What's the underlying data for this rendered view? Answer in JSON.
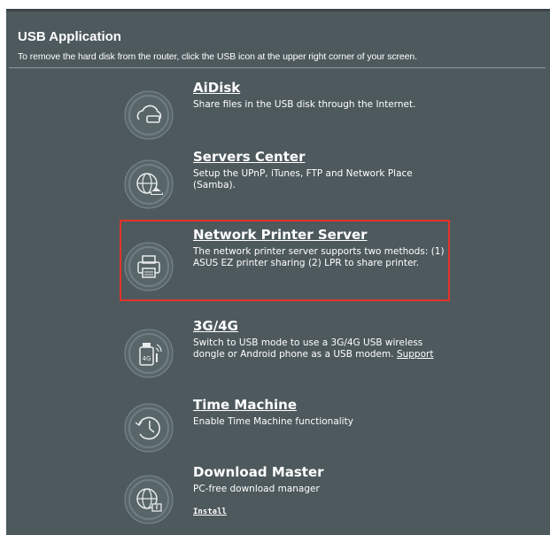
{
  "header": {
    "title": "USB Application",
    "subtitle": "To remove the hard disk from the router, click the USB icon at the upper right corner of your screen."
  },
  "apps": [
    {
      "title": "AiDisk",
      "description": "Share files in the USB disk through the Internet.",
      "icon": "cloud-disk-icon"
    },
    {
      "title": "Servers Center",
      "description": "Setup the UPnP, iTunes, FTP and Network Place (Samba).",
      "icon": "globe-server-icon"
    },
    {
      "title": "Network Printer Server",
      "description": "The network printer server supports two methods: (1) ASUS EZ printer sharing (2) LPR to share printer.",
      "icon": "printer-icon",
      "highlighted": true
    },
    {
      "title": "3G/4G",
      "description": "Switch to USB mode to use a 3G/4G USB wireless dongle or Android phone as a USB modem.",
      "link": "Support",
      "icon": "usb-modem-icon",
      "badge": "4G"
    },
    {
      "title": "Time Machine",
      "description": "Enable Time Machine functionality",
      "icon": "clock-icon"
    },
    {
      "title": "Download Master",
      "description": "PC-free download manager",
      "action": "Install",
      "icon": "globe-download-icon"
    }
  ],
  "colors": {
    "panel": "#4d595d",
    "highlight": "#e5332a",
    "text": "#ffffff"
  }
}
